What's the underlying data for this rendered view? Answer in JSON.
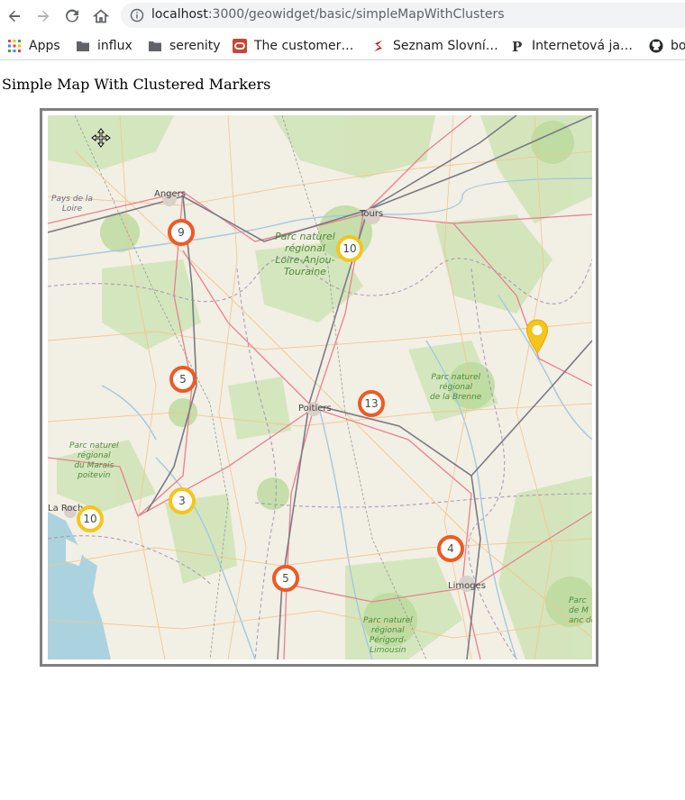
{
  "browser": {
    "url_host": "localhost",
    "url_path": ":3000/geowidget/basic/simpleMapWithClusters",
    "bookmarks": [
      {
        "label": "Apps",
        "icon": "apps-grid-icon"
      },
      {
        "label": "influx",
        "icon": "folder-icon"
      },
      {
        "label": "serenity",
        "icon": "folder-icon"
      },
      {
        "label": "The customer…",
        "icon": "oracle-icon"
      },
      {
        "label": "Seznam Slovní…",
        "icon": "seznam-icon"
      },
      {
        "label": "Internetová ja…",
        "icon": "p-icon"
      },
      {
        "label": "bo",
        "icon": "github-icon"
      }
    ]
  },
  "page": {
    "title": "Simple Map With Clustered Markers"
  },
  "map": {
    "colors": {
      "cluster_orange": "#ee5a24",
      "cluster_yellow": "#f5c518",
      "marker": "#f5c518",
      "land": "#f2efe4",
      "forest": "#cde3b4",
      "water": "#aad3df"
    },
    "clusters": [
      {
        "count": "9",
        "color": "orange"
      },
      {
        "count": "10",
        "color": "yellow"
      },
      {
        "count": "5",
        "color": "orange"
      },
      {
        "count": "13",
        "color": "orange"
      },
      {
        "count": "3",
        "color": "yellow"
      },
      {
        "count": "10",
        "color": "yellow"
      },
      {
        "count": "4",
        "color": "orange"
      },
      {
        "count": "5",
        "color": "orange"
      }
    ],
    "places": {
      "angers": "Angers",
      "tours": "Tours",
      "poitiers": "Poitiers",
      "limoges": "Limoges",
      "la_rochelle": "La Roch",
      "pays_de_la_loire_1": "Pays de la",
      "pays_de_la_loire_2": "Loire"
    },
    "parks": {
      "loire_anjou": [
        "Parc naturel",
        "régional",
        "Loire-Anjou-",
        "Touraine"
      ],
      "brenne": [
        "Parc naturel",
        "régional",
        "de la Brenne"
      ],
      "marais": [
        "Parc naturel",
        "régional",
        "du Marais",
        "poitevin"
      ],
      "perigord": [
        "Parc naturel",
        "régional",
        "Périgord-",
        "Limousin"
      ],
      "edge": [
        "Parc",
        "de M",
        "anc de"
      ]
    }
  }
}
